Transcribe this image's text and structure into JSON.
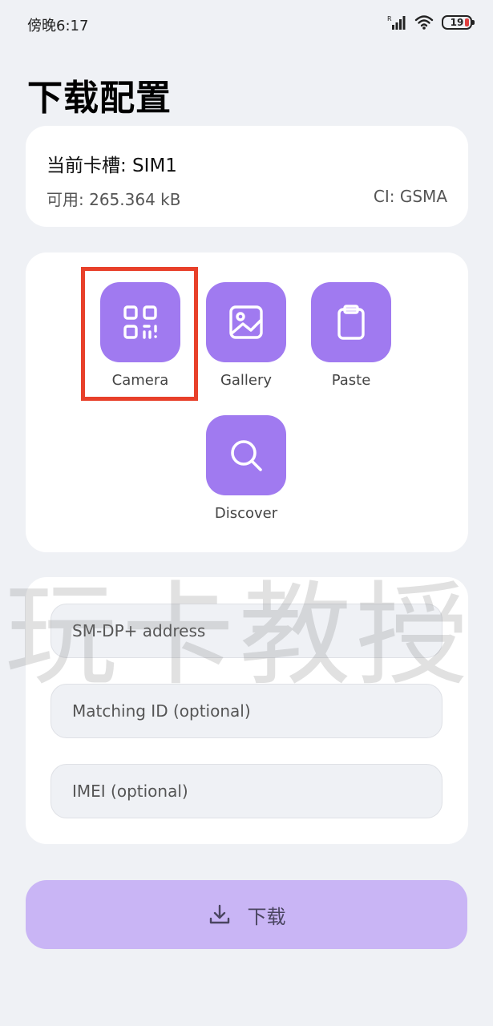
{
  "status_bar": {
    "time": "傍晚6:17",
    "battery_level": "19"
  },
  "header": {
    "title": "下载配置"
  },
  "sim_card": {
    "slot": "当前卡槽: SIM1",
    "available": "可用: 265.364 kB",
    "ci": "CI: GSMA"
  },
  "actions": [
    {
      "label": "Camera",
      "icon": "qr-code-icon"
    },
    {
      "label": "Gallery",
      "icon": "image-icon"
    },
    {
      "label": "Paste",
      "icon": "clipboard-icon"
    },
    {
      "label": "Discover",
      "icon": "search-icon"
    }
  ],
  "watermark": "玩卡教授",
  "form": {
    "smdp_placeholder": "SM-DP+ address",
    "matching_id_placeholder": "Matching ID (optional)",
    "imei_placeholder": "IMEI (optional)"
  },
  "download_button": {
    "label": "下载"
  },
  "colors": {
    "accent": "#a07af0",
    "button_disabled": "#c9b5f5",
    "highlight_box": "#e8402a",
    "background": "#eff1f5"
  }
}
